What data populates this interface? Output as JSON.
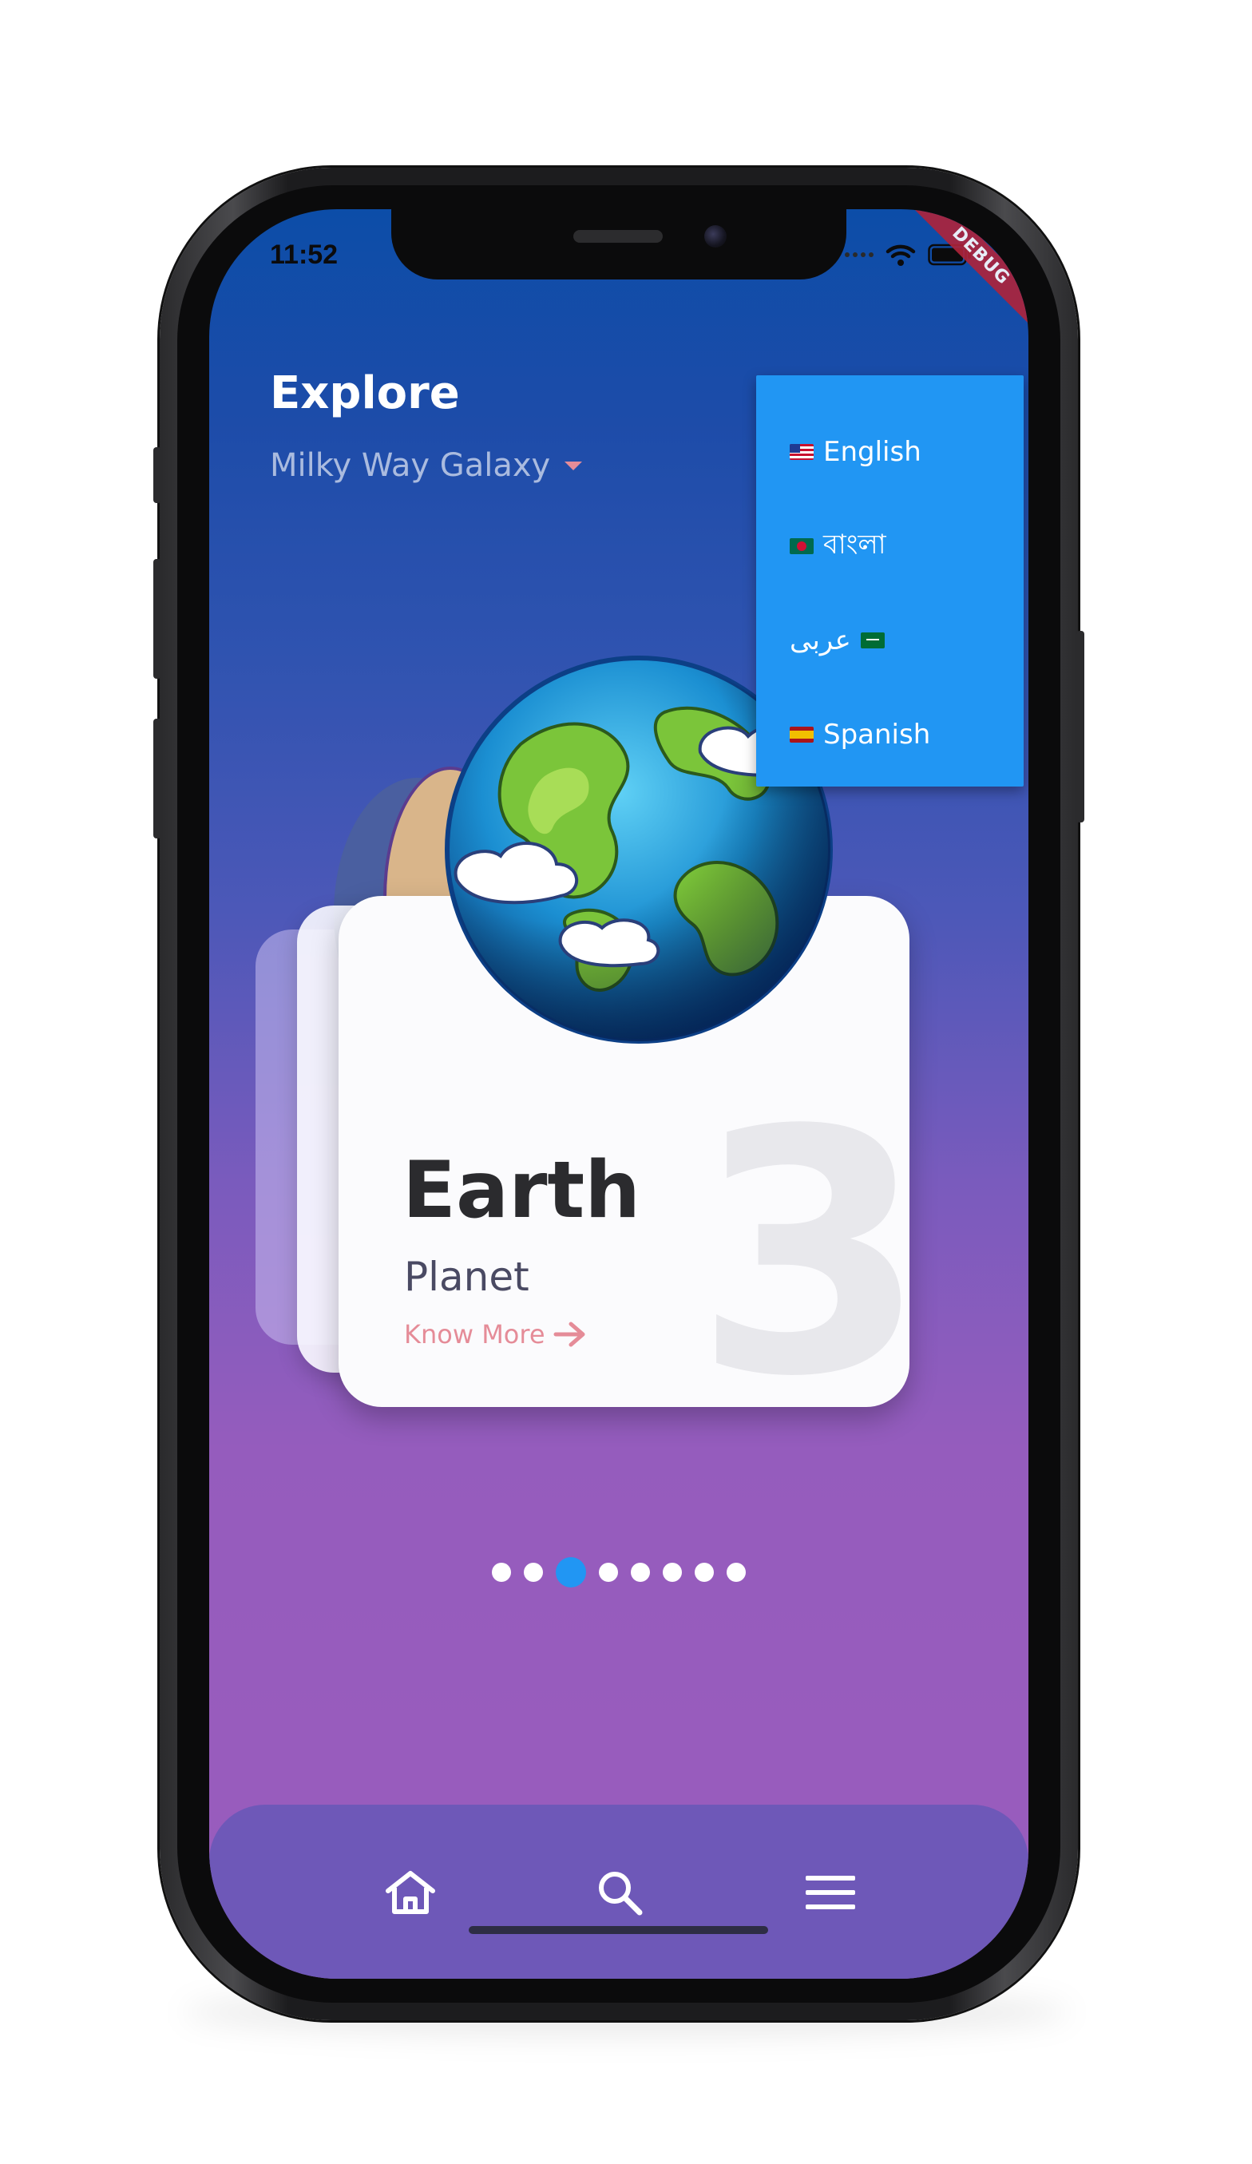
{
  "status_bar": {
    "time": "11:52",
    "debug_label": "DEBUG"
  },
  "header": {
    "title": "Explore",
    "galaxy": "Milky Way Galaxy"
  },
  "language_menu": {
    "items": [
      {
        "label": "English",
        "flag": "us-flag-icon"
      },
      {
        "label": "বাংলা",
        "flag": "bangladesh-flag-icon"
      },
      {
        "label": "عربى",
        "flag": "saudi-flag-icon"
      },
      {
        "label": "Spanish",
        "flag": "spain-flag-icon"
      }
    ],
    "background": "#2196f3"
  },
  "card": {
    "number": "3",
    "title": "Earth",
    "subtitle": "Planet",
    "link": "Know More"
  },
  "pagination": {
    "total": 8,
    "active_index": 2,
    "active_color": "#2196f3"
  },
  "bottom_nav": {
    "items": [
      "home-icon",
      "search-icon",
      "menu-icon"
    ],
    "background": "#6e58b8"
  },
  "colors": {
    "gradient_top": "#0c4da8",
    "gradient_bottom": "#9a5cbd",
    "accent_pink": "#e58c98"
  }
}
